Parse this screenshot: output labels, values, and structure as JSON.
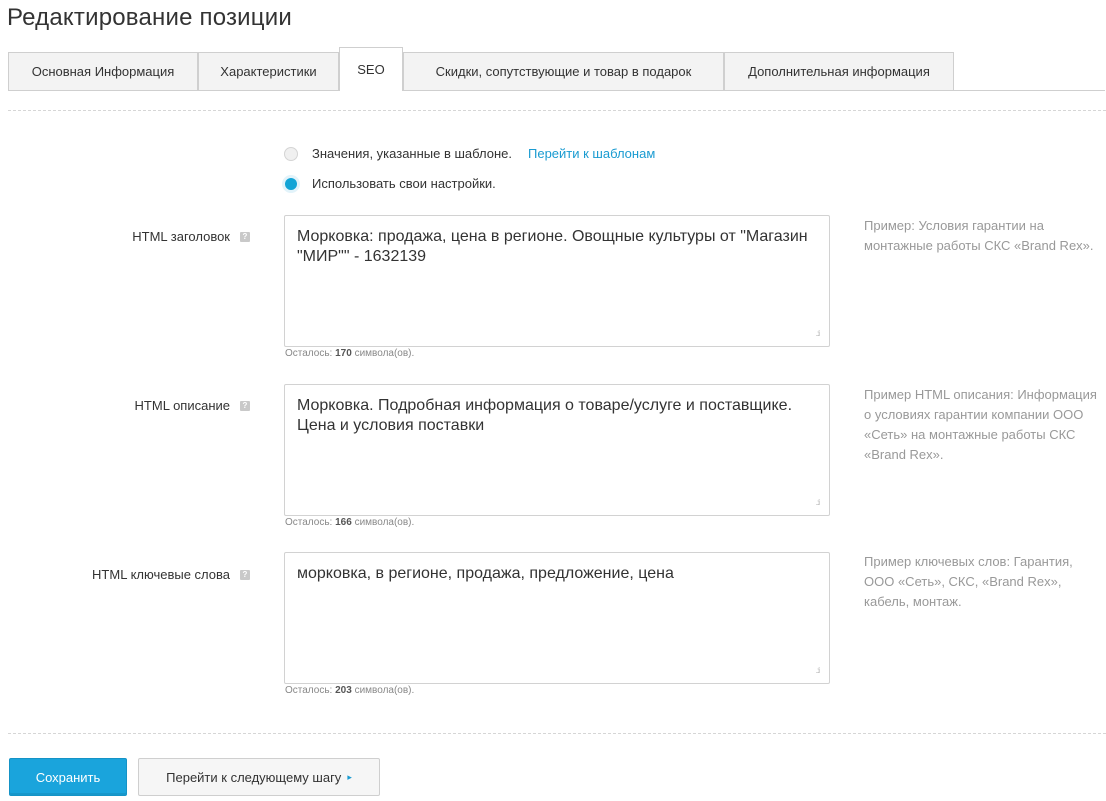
{
  "page_title": "Редактирование позиции",
  "tabs": [
    {
      "label": "Основная Информация",
      "active": false
    },
    {
      "label": "Характеристики",
      "active": false
    },
    {
      "label": "SEO",
      "active": true
    },
    {
      "label": "Скидки, сопутствующие и товар в подарок",
      "active": false
    },
    {
      "label": "Дополнительная информация",
      "active": false
    }
  ],
  "mode": {
    "template_option": "Значения, указанные в шаблоне.",
    "template_link": "Перейти к шаблонам",
    "custom_option": "Использовать свои настройки.",
    "selected": "custom"
  },
  "fields": [
    {
      "label": "HTML заголовок",
      "value": "Морковка: продажа, цена в регионе. Овощные культуры от \"Магазин \"МИР\"\" - 1632139",
      "remain_prefix": "Осталось:",
      "remain_count": "170",
      "remain_suffix": "символа(ов).",
      "hint": "Пример: Условия гарантии на монтажные работы СКС «Brand Rex»."
    },
    {
      "label": "HTML описание",
      "value": "Морковка. Подробная информация о товаре/услуге и поставщике. Цена и условия поставки",
      "remain_prefix": "Осталось:",
      "remain_count": "166",
      "remain_suffix": "символа(ов).",
      "hint": "Пример HTML описания: Информация о условиях гарантии компании ООО «Сеть» на монтажные работы СКС «Brand Rex»."
    },
    {
      "label": "HTML ключевые слова",
      "value": "морковка, в регионе, продажа, предложение, цена",
      "remain_prefix": "Осталось:",
      "remain_count": "203",
      "remain_suffix": "символа(ов).",
      "hint": "Пример ключевых слов: Гарантия, ООО «Сеть», СКС, «Brand Rex», кабель, монтаж."
    }
  ],
  "help_icon": "?",
  "buttons": {
    "save": "Сохранить",
    "next": "Перейти к следующему шагу",
    "next_arrow": "▸"
  },
  "colors": {
    "accent": "#1aa4dc",
    "link": "#1a9bd1",
    "hint_text": "#999999"
  }
}
